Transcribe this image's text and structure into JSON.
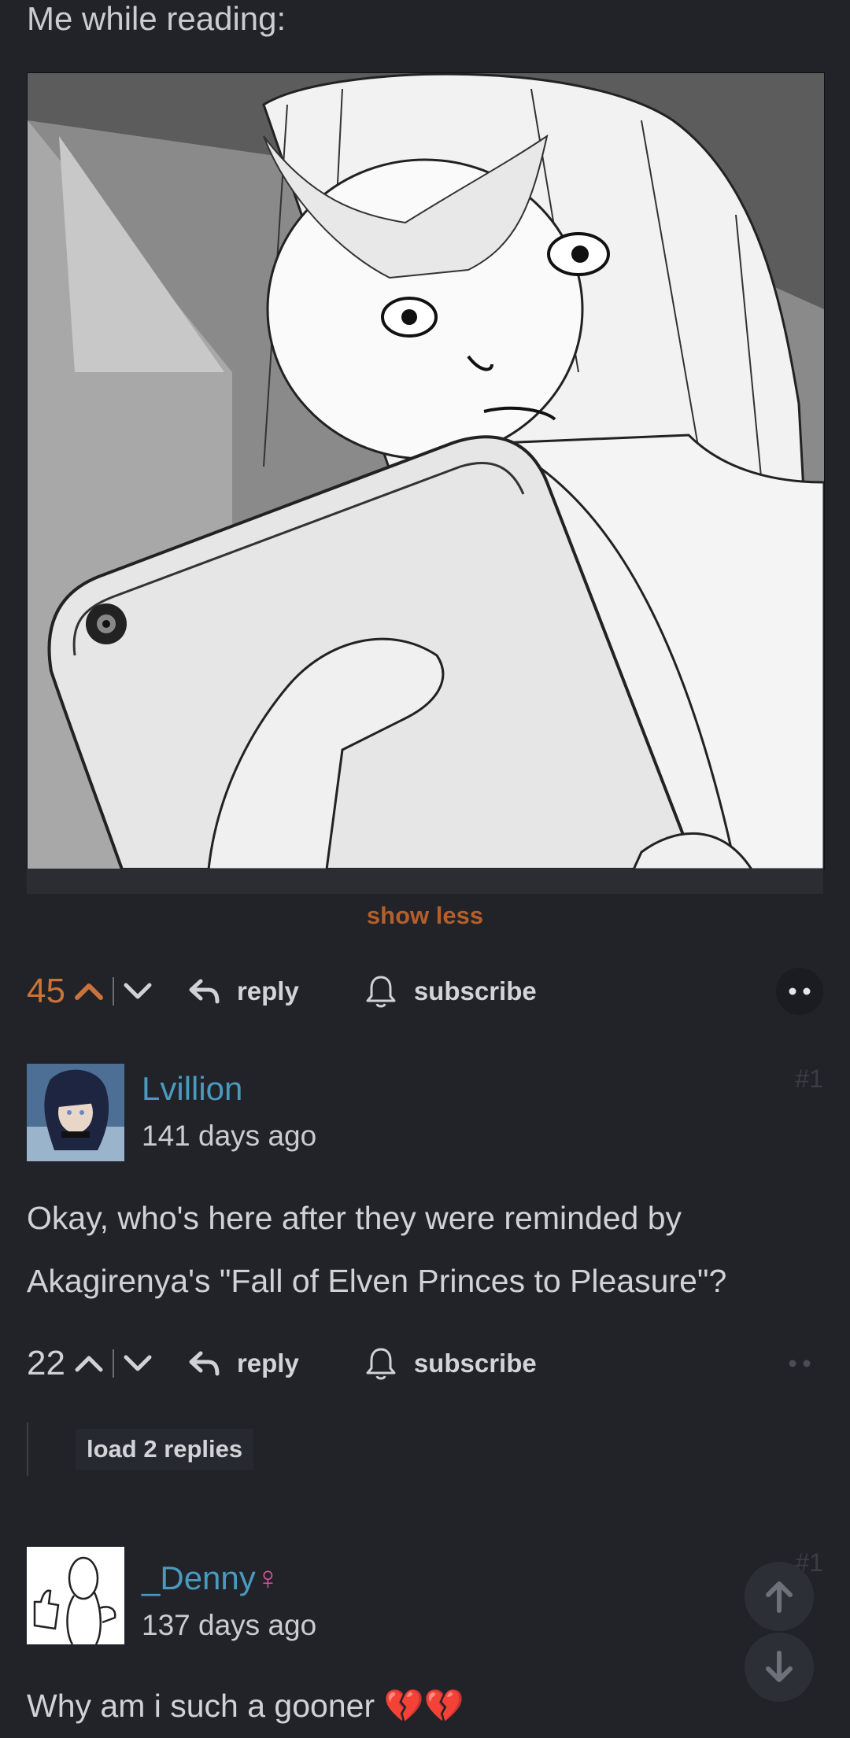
{
  "post": {
    "caption": "Me while reading:",
    "show_less_label": "show less",
    "score": "45",
    "reply_label": "reply",
    "subscribe_label": "subscribe"
  },
  "comments": [
    {
      "username": "Lvillion",
      "time": "141 days ago",
      "index": "#1",
      "text_line1": "Okay, who's here after they were reminded by",
      "text_line2": "Akagirenya's \"Fall of Elven Princes to Pleasure\"?",
      "score": "22",
      "reply_label": "reply",
      "subscribe_label": "subscribe",
      "load_replies_label": "load 2 replies"
    },
    {
      "username": "_Denny",
      "gender_symbol": "♀",
      "time": "137 days ago",
      "index": "#1",
      "text": "Why am i such a gooner",
      "emoji": "💔💔"
    }
  ],
  "colors": {
    "background": "#212329",
    "accent_orange": "#c8733a",
    "username_blue": "#4a9ac0",
    "female_pink": "#d9509b"
  }
}
